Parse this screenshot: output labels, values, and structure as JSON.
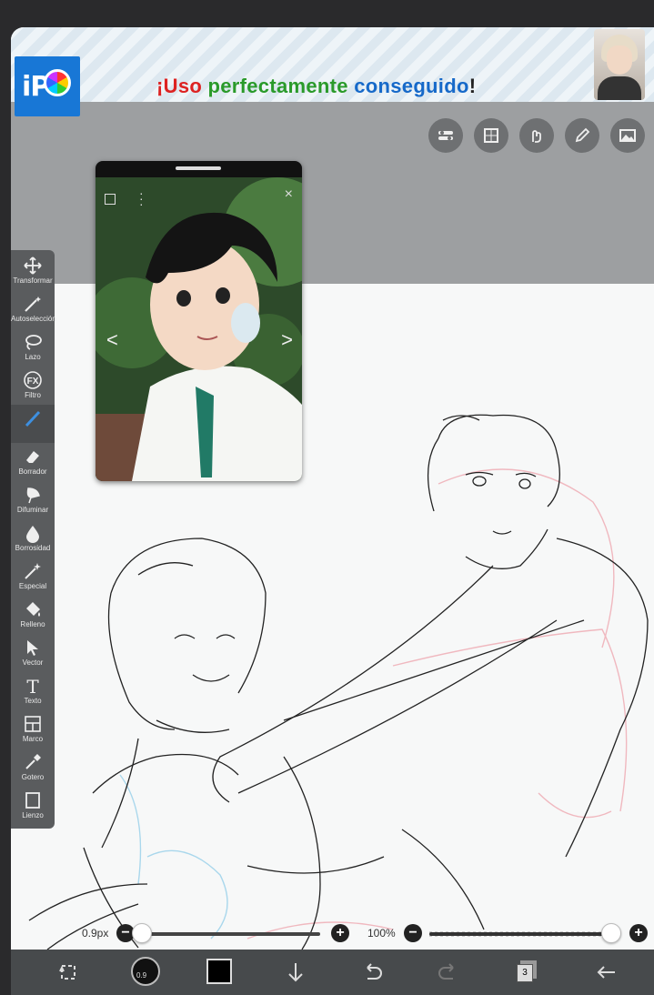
{
  "banner": {
    "message_parts": [
      "¡Uso",
      "perfectamente",
      "conseguido",
      "!"
    ],
    "logo_text": "iP"
  },
  "top_tools": [
    "layers-toggle-icon",
    "grid-icon",
    "gesture-icon",
    "pencil-icon",
    "image-icon"
  ],
  "tools": [
    {
      "label": "Transformar",
      "icon": "move-icon"
    },
    {
      "label": "Autoselección",
      "icon": "magic-wand-icon"
    },
    {
      "label": "Lazo",
      "icon": "lasso-icon"
    },
    {
      "label": "Filtro",
      "icon": "fx-icon"
    },
    {
      "label": "",
      "icon": "brush-icon"
    },
    {
      "label": "Borrador",
      "icon": "eraser-icon"
    },
    {
      "label": "Difuminar",
      "icon": "smudge-icon"
    },
    {
      "label": "Borrosidad",
      "icon": "blur-icon"
    },
    {
      "label": "Especial",
      "icon": "sparkle-icon"
    },
    {
      "label": "Relleno",
      "icon": "fill-icon"
    },
    {
      "label": "Vector",
      "icon": "vector-icon"
    },
    {
      "label": "Texto",
      "icon": "text-icon"
    },
    {
      "label": "Marco",
      "icon": "frame-icon"
    },
    {
      "label": "Gotero",
      "icon": "eyedropper-icon"
    },
    {
      "label": "Lienzo",
      "icon": "canvas-icon"
    }
  ],
  "reference": {
    "close": "×",
    "prev": "<",
    "next": ">"
  },
  "sliders": {
    "brush_size_label": "0.9px",
    "brush_size_fraction": 0.02,
    "opacity_label": "100%",
    "opacity_fraction": 1.0
  },
  "bottom_bar": {
    "brush_size_badge": "0.9",
    "color": "#000000",
    "layer_count": "3"
  },
  "colors": {
    "panel": "#5a5c5e",
    "bottom_bar": "#474a4c",
    "accent_blue": "#1877d6"
  }
}
